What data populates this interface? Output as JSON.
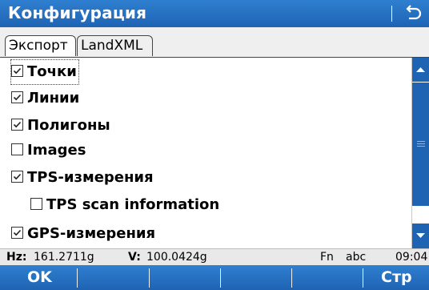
{
  "title": "Конфигурация",
  "tabs": [
    {
      "label": "Экспорт",
      "active": true
    },
    {
      "label": "LandXML",
      "active": false
    }
  ],
  "items": [
    {
      "label": "Точки",
      "checked": true,
      "indent": false,
      "focused": true
    },
    {
      "label": "Линии",
      "checked": true,
      "indent": false,
      "focused": false
    },
    {
      "label": "Полигоны",
      "checked": true,
      "indent": false,
      "focused": false
    },
    {
      "label": "Images",
      "checked": false,
      "indent": false,
      "focused": false
    },
    {
      "label": "TPS-измерения",
      "checked": true,
      "indent": false,
      "focused": false
    },
    {
      "label": "TPS scan information",
      "checked": false,
      "indent": true,
      "focused": false
    },
    {
      "label": "GPS-измерения",
      "checked": true,
      "indent": false,
      "focused": false
    }
  ],
  "status": {
    "hz_label": "Hz:",
    "hz_value": "161.2711g",
    "v_label": "V:",
    "v_value": "100.0424g",
    "fn": "Fn",
    "mode": "abc",
    "time": "09:04"
  },
  "softkeys": {
    "ok": "OK",
    "page": "Стр"
  },
  "colors": {
    "accent": "#1f63b3",
    "statusbar": "#e9e9e9"
  }
}
